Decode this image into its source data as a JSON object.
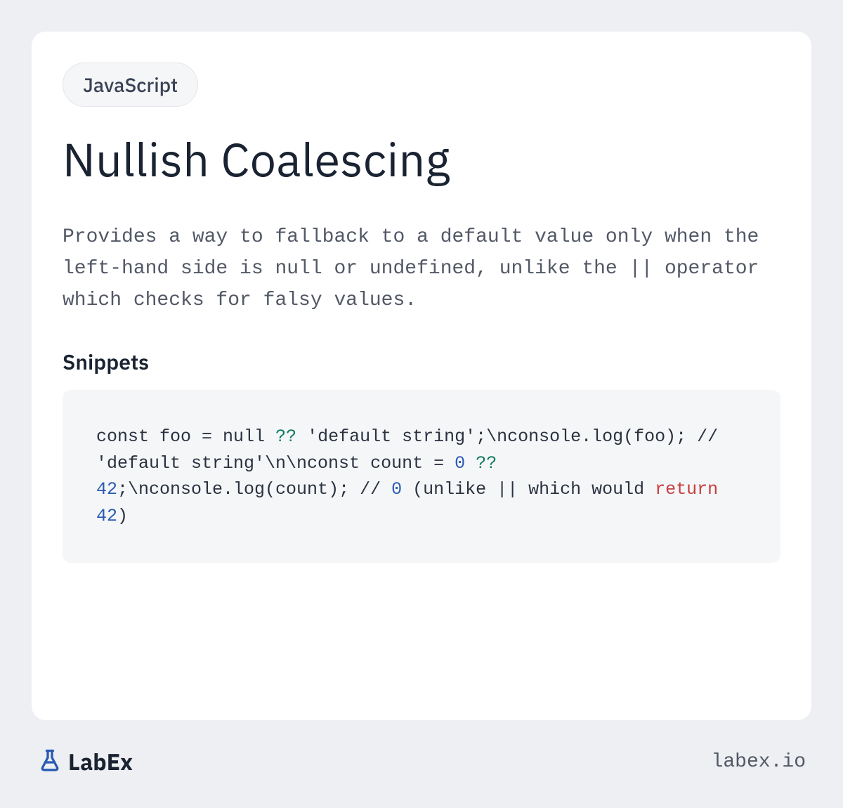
{
  "tag": "JavaScript",
  "title": "Nullish Coalescing",
  "description": "Provides a way to fallback to a default value only when the left-hand side is null or undefined, unlike the || operator which checks for falsy values.",
  "section_heading": "Snippets",
  "code": {
    "tokens": [
      {
        "text": "const foo = null ",
        "class": ""
      },
      {
        "text": "??",
        "class": "kw-operator"
      },
      {
        "text": " 'default string';\\nconsole.log(foo); // 'default string'\\n\\nconst count = ",
        "class": ""
      },
      {
        "text": "0",
        "class": "kw-number"
      },
      {
        "text": " ",
        "class": ""
      },
      {
        "text": "??",
        "class": "kw-operator"
      },
      {
        "text": " ",
        "class": ""
      },
      {
        "text": "42",
        "class": "kw-number"
      },
      {
        "text": ";\\nconsole.log(count); // ",
        "class": ""
      },
      {
        "text": "0",
        "class": "kw-number"
      },
      {
        "text": " (unlike || which would ",
        "class": ""
      },
      {
        "text": "return",
        "class": "kw-return"
      },
      {
        "text": " ",
        "class": ""
      },
      {
        "text": "42",
        "class": "kw-number"
      },
      {
        "text": ")",
        "class": ""
      }
    ]
  },
  "footer": {
    "brand": "LabEx",
    "url": "labex.io"
  }
}
